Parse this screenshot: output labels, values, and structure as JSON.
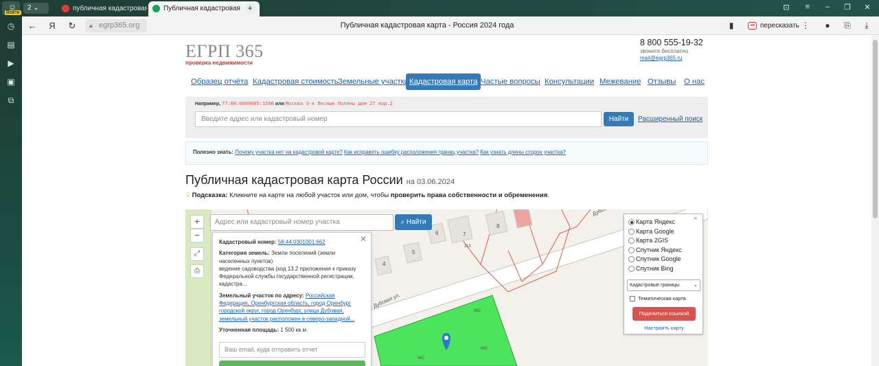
{
  "browser": {
    "login_label": "Войти",
    "tab_counter": "2",
    "tabs": [
      {
        "title": "публичная кадастровая к",
        "active": false
      },
      {
        "title": "Публичная кадастровая",
        "active": true
      }
    ],
    "url": "egrp365.org",
    "page_title": "Публичная кадастровая карта - Россия 2024 года",
    "retell_label": "пересказать"
  },
  "header": {
    "logo_main": "ЕГРП 365",
    "logo_sub": "проверка недвижимости",
    "phone": "8 800 555-19-32",
    "phone_note": "звоните бесплатно",
    "email": "mail@egrp365.ru"
  },
  "menu": [
    {
      "label": "Образец отчёта",
      "current": false
    },
    {
      "label": "Кадастровая стоимость",
      "current": false
    },
    {
      "label": "Земельные участки",
      "current": false
    },
    {
      "label": "Кадастровая карта",
      "current": true
    },
    {
      "label": "Частые вопросы",
      "current": false
    },
    {
      "label": "Консультации",
      "current": false
    },
    {
      "label": "Межевание",
      "current": false
    },
    {
      "label": "Отзывы",
      "current": false
    },
    {
      "label": "О нас",
      "current": false
    }
  ],
  "search": {
    "example_prefix": "Например,",
    "example_number": "77:08:0009005:1596",
    "example_or": "или",
    "example_address": "Москва 3-я Лесные Поляны дом 27 кор.2",
    "placeholder": "Введите адрес или кадастровый номер",
    "button": "Найти",
    "advanced": "Расширенный поиск"
  },
  "useful": {
    "title": "Полезно знать:",
    "links": [
      "Почему участка нет на кадастровой карте?",
      "Как исправить ошибку расположения границ участка?",
      "Как узнать длины сторон участка?"
    ]
  },
  "heading": {
    "title": "Публичная кадастровая карта России",
    "date": "на 03.06.2024"
  },
  "hint": {
    "label": "Подсказка:",
    "text": "Кликните на карте на любой участок или дом, чтобы",
    "bold": "проверить права собственности и обременения",
    "end": "."
  },
  "map": {
    "search_placeholder": "Адрес или кадастровый номер участка",
    "search_button": "Найти",
    "street_label": "Дубовая ул.",
    "street_label_2": "Дубов",
    "house_numbers": [
      "4",
      "5",
      "6",
      "7",
      "8",
      "113"
    ],
    "parcel_labels": [
      "662",
      "662",
      "662"
    ],
    "popup": {
      "cad_label": "Кадастровый номер:",
      "cad_number": "56:44:0301001:662",
      "category_label": "Категория земель:",
      "category_value": "Земли поселений (земли населенных пунктов)",
      "category_extra": "ведение садоводства (код 13.2 приложения к приказу Федеральной службы государственной регистрации, кадастра...",
      "address_label": "Земельный участок по адресу:",
      "address_value": "Российская Федерация, Оренбургская область, город Оренбург городской округ, город Оренбург, улица Дубовая, земельный участок расположен в северо-западной...",
      "area_label": "Уточненная площадь:",
      "area_value": "1 500 кв.м.",
      "email_placeholder": "Ваш email, куда отправить отчет"
    },
    "layers": {
      "options": [
        {
          "label": "Карта Яндекс",
          "checked": true
        },
        {
          "label": "Карта Google",
          "checked": false
        },
        {
          "label": "Карта 2GIS",
          "checked": false
        },
        {
          "label": "Спутник Яндекс",
          "checked": false
        },
        {
          "label": "Спутник Google",
          "checked": false
        },
        {
          "label": "Спутник Bing",
          "checked": false
        }
      ],
      "select_value": "Кадастровые границы",
      "thematic_label": "Тематическая карта",
      "share_button": "Поделиться ссылкой",
      "setup_link": "Настроить карту"
    }
  },
  "colors": {
    "link": "#1a5fa8",
    "primary": "#337ab7",
    "danger": "#d9534f",
    "parcel_fill": "#4ce45c",
    "logo_accent": "#c0392b"
  }
}
